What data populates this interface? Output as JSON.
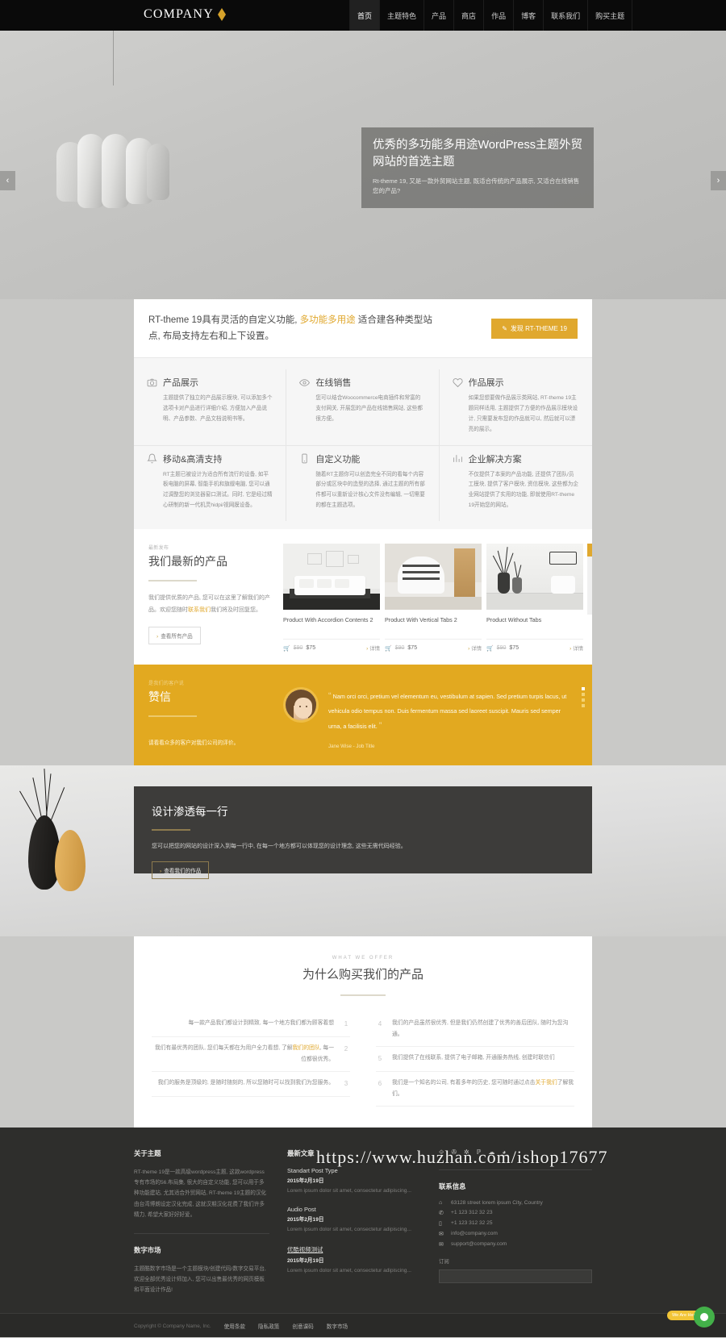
{
  "header": {
    "logo_text": "COMPANY",
    "nav": [
      {
        "label": "首页",
        "active": true
      },
      {
        "label": "主题特色",
        "active": false
      },
      {
        "label": "产品",
        "active": false
      },
      {
        "label": "商店",
        "active": false
      },
      {
        "label": "作品",
        "active": false
      },
      {
        "label": "博客",
        "active": false
      },
      {
        "label": "联系我们",
        "active": false
      },
      {
        "label": "购买主题",
        "active": false
      }
    ]
  },
  "hero": {
    "title": "优秀的多功能多用途WordPress主题外贸网站的首选主题",
    "subtitle": "Rt-theme 19, 又是一款外贸网站主题, 既适合传统的产品展示, 又适合在线销售您的产品?",
    "prev_arrow": "‹",
    "next_arrow": "›"
  },
  "intro": {
    "text_part1": "RT-theme 19具有灵活的自定义功能, ",
    "highlight": "多功能多用途",
    "text_part2": " 适合建各种类型站点, 布局支持左右和上下设置。",
    "button": "发现 RT-THEME 19"
  },
  "features": [
    {
      "icon": "camera-icon",
      "title": "产品展示",
      "desc": "主题提供了独立的产品展示模块, 可以添加多个选项卡对产品进行详细介绍, 方便加入产品说明、产品参数、产品文档说明书等。"
    },
    {
      "icon": "eye-icon",
      "title": "在线销售",
      "desc": "您可以结合Woocommerce电商插件和常富的支付网关, 开展您的产品在线销售网站, 这些都很方便。"
    },
    {
      "icon": "heart-icon",
      "title": "作品展示",
      "desc": "如果您想要做作品展示类网站, RT-theme 19主题同样适用, 主题提供了方便的作品展示模块设计, 只需要发布您的作品就可以, 然后就可以漂亮的展示。"
    },
    {
      "icon": "bell-icon",
      "title": "移动&高清支持",
      "desc": "RT主题已被设计为适合所有流行的设备, 如平板电脑的屏幕, 智能手机和旗舰电脑, 您可以通过调整您的浏览器窗口测试。同时, 它是经过精心研制的新一代机灵hidpi/视网膜设备。"
    },
    {
      "icon": "mobile-icon",
      "title": "自定义功能",
      "desc": "随着RT主题你可以创造完全不同的看每个内容部分或区块中的造型的选择, 通过主题的所有部件都可以重新设计核心文件没有编辑, 一切需要的都在主题选项。"
    },
    {
      "icon": "chart-icon",
      "title": "企业解决方案",
      "desc": "不仅提供了本案的产品功能, 还提供了团队/员工模块, 提供了客户模块, 资信模块, 这些都为企业网站提供了实用的功能, 即就使用RT-theme 19开始您的网站。"
    }
  ],
  "products": {
    "eyebrow": "最新发布",
    "title": "我们最新的产品",
    "desc_part1": "我们提供优质的产品, 您可以在这里了解我们的产品。欢迎您随时",
    "desc_link": "联系我们",
    "desc_part2": "我们将及时回复您。",
    "view_all": "查看所有产品",
    "items": [
      {
        "name": "Product With Accordion Contents 2",
        "price_old": "$90",
        "price_new": "$75",
        "detail": "详情"
      },
      {
        "name": "Product With Vertical Tabs 2",
        "price_old": "$90",
        "price_new": "$75",
        "detail": "详情"
      },
      {
        "name": "Product Without Tabs",
        "price_old": "$90",
        "price_new": "$75",
        "detail": "详情"
      }
    ]
  },
  "testimonial": {
    "eyebrow": "是我们的客户说",
    "title": "赞信",
    "lead": "请看看众多的客户对我们公司的评价。",
    "quote": "Nam orci orci, pretium vel elementum eu, vestibulum at sapien. Sed pretium turpis lacus, ut vehicula odio tempus non. Duis fermentum massa sed laoreet suscipit. Mauris sed semper urna, a facilisis elit.",
    "author": "Jane Wise  -  Job Title",
    "quote_open": "“",
    "quote_close": "”"
  },
  "design": {
    "title": "设计渗透每一行",
    "desc": "您可以把您的网站的设计深入到每一行中, 在每一个地方都可以体现您的设计理念, 这些无需代码经验。",
    "button": "查看我们的作品"
  },
  "offer": {
    "eyebrow": "WHAT WE OFFER",
    "title": "为什么购买我们的产品",
    "left": [
      {
        "num": "1",
        "text": "每一款产品我们都设计到精致, 每一个地方我们都为顾客着想"
      },
      {
        "num": "2",
        "text_part1": "我们有最优秀的团队, 您们每天都在为用户全力看想, 了解",
        "link": "我们的团队",
        "text_part2": ", 每一位都很优秀。"
      },
      {
        "num": "3",
        "text": "我们的服务是顶级的, 是随时随刻的, 所以您随时可以找到我们为您服务。"
      }
    ],
    "right": [
      {
        "num": "4",
        "text": "我们的产品虽然很优秀, 但是我们仍然创建了优秀的善后团队, 随时为您沟通。"
      },
      {
        "num": "5",
        "text": "我们提供了在线联系, 提供了电子邮箱, 开通服务热线, 创建时联信们"
      },
      {
        "num": "6",
        "text_part1": "我们是一个知名的公司, 有着多年的历史, 您可随时通过点击",
        "link": "关于我们",
        "text_part2": "了解我们。"
      }
    ]
  },
  "footer": {
    "about_title": "关于主题",
    "about_text": "RT-theme 19是一款高级wordpress主题, 这款wordpress专有市场的56.布局集, 很大的自定义功能, 您可以用于多种功能建站, 尤其适合外贸网站, RT-theme 19主题的汉化由台湾博朗设定汉化完成, 这就汉期汉化花费了我们许多精力, 希望大家好好好爱。",
    "market_title": "数字市场",
    "market_text": "主题酷数字市场是一个主题模块/创建代码/数字交易平台, 欢迎全部优秀设计师加入, 您可以出售最优秀的网页模板和平面设计作品!",
    "posts_title": "最新文章",
    "posts": [
      {
        "title": "Standart Post Type",
        "date": "2015年2月19日",
        "excerpt": "Lorem ipsum dolor sit amet, consectetur adipiscing...",
        "underline": false
      },
      {
        "title": "Audio Post",
        "date": "2015年2月19日",
        "excerpt": "Lorem ipsum dolor sit amet, consectetur adipiscing...",
        "underline": false
      },
      {
        "title": "优酷视频测试",
        "date": "2015年2月19日",
        "excerpt": "Lorem ipsum dolor sit amet, consectetur adipiscing...",
        "underline": true
      }
    ],
    "socials": [
      "rss-icon",
      "twitter-icon",
      "dribbble-icon",
      "pinterest-icon",
      "cloud-icon",
      "clock-icon"
    ],
    "contact_title": "联系信息",
    "contact": [
      {
        "icon": "home-icon",
        "text": "63128 street lorem ipsum City, Country"
      },
      {
        "icon": "phone-icon",
        "text": "+1 123 312 32 23"
      },
      {
        "icon": "mobile-icon",
        "text": "+1 123 312 32 25"
      },
      {
        "icon": "mail-icon",
        "text": "info@company.com"
      },
      {
        "icon": "support-icon",
        "text": "support@company.com"
      }
    ],
    "newsletter_label": "订阅",
    "copyright": "Copyright © Company Name, Inc.",
    "bottom_links": [
      "使用条款",
      "隐私政策",
      "创意课码",
      "数字市场"
    ]
  },
  "watermark": {
    "url": "https://www.huzhan.com/ishop17677",
    "chat_label": "We Are Here!"
  }
}
